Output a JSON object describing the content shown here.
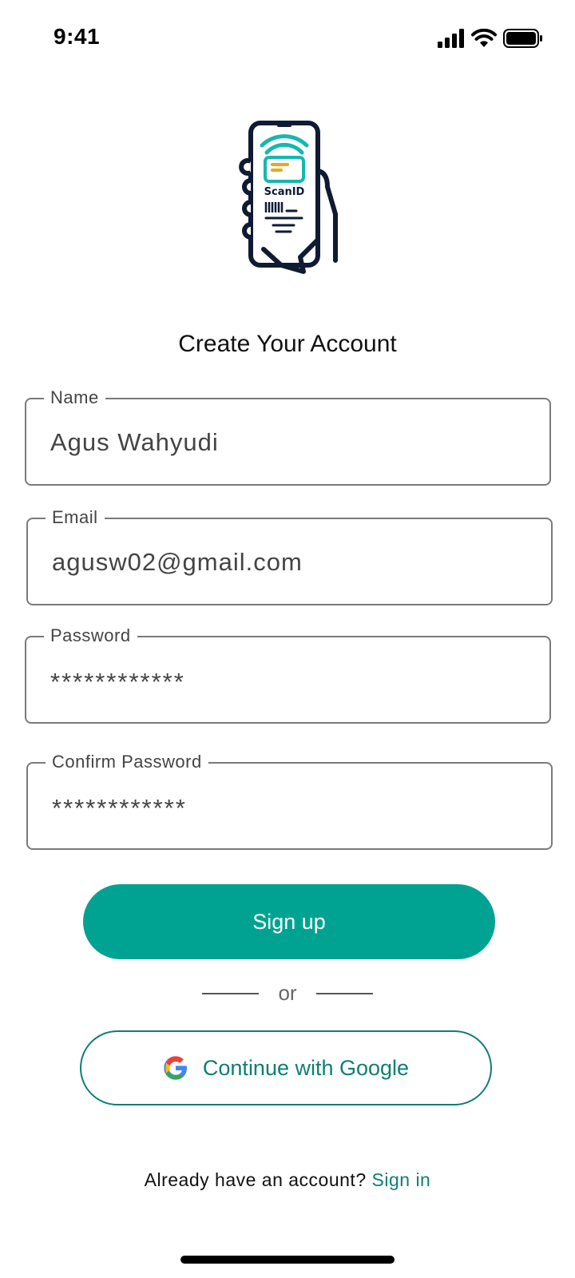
{
  "status_bar": {
    "time": "9:41"
  },
  "logo": {
    "text": "ScanID"
  },
  "page": {
    "title": "Create Your Account"
  },
  "form": {
    "name": {
      "label": "Name",
      "value": "Agus Wahyudi"
    },
    "email": {
      "label": "Email",
      "value": "agusw02@gmail.com"
    },
    "password": {
      "label": "Password",
      "value": "************"
    },
    "confirm_password": {
      "label": "Confirm Password",
      "value": "************"
    }
  },
  "actions": {
    "signup_label": "Sign up",
    "divider_text": "or",
    "google_label": "Continue with Google",
    "signin_prompt": "Already have an account?",
    "signin_link": "Sign in"
  },
  "colors": {
    "primary": "#00a391",
    "accent_text": "#0e7e73",
    "logo_dark": "#0f1b33",
    "logo_teal": "#14b8b0",
    "logo_amber": "#f0a818"
  },
  "icons": [
    "cellular-signal-icon",
    "wifi-icon",
    "battery-icon",
    "google-icon"
  ]
}
